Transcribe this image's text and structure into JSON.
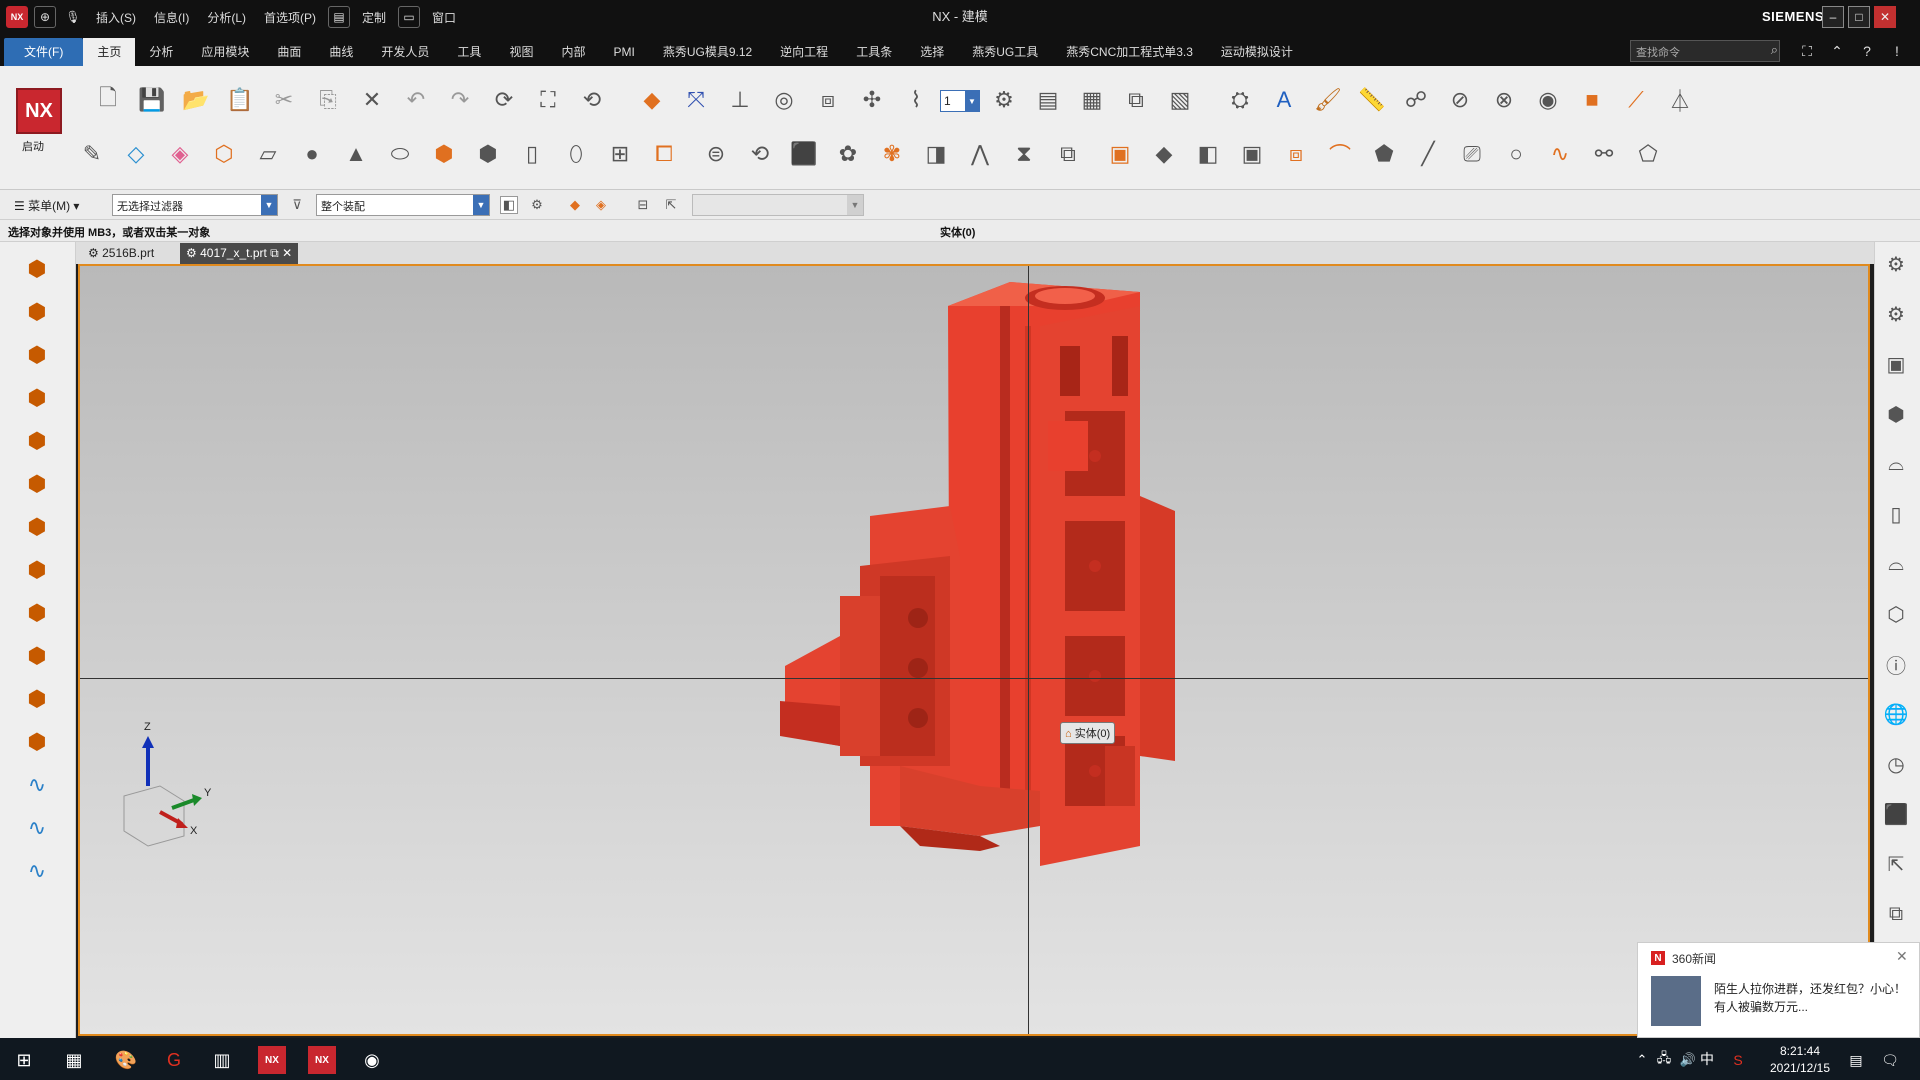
{
  "window": {
    "title": "NX - 建模",
    "brand": "SIEMENS"
  },
  "quick_access": {
    "menus": [
      "插入(S)",
      "信息(I)",
      "分析(L)",
      "首选项(P)",
      "定制",
      "窗口"
    ]
  },
  "ribbon": {
    "file_tab": "文件(F)",
    "tabs": [
      "主页",
      "分析",
      "应用模块",
      "曲面",
      "曲线",
      "开发人员",
      "工具",
      "视图",
      "内部",
      "PMI",
      "燕秀UG模具9.12",
      "逆向工程",
      "工具条",
      "选择",
      "燕秀UG工具",
      "燕秀CNC加工程式单3.3",
      "运动模拟设计"
    ],
    "active_tab": "主页",
    "search_placeholder": "查找命令",
    "start_label": "启动",
    "logo_text": "NX",
    "layer_value": "1"
  },
  "command_bar": {
    "menu_label": "菜单(M)",
    "filter_value": "无选择过滤器",
    "assembly_value": "整个装配"
  },
  "status": {
    "left": "选择对象并使用 MB3，或者双击某一对象",
    "right": "实体(0)"
  },
  "doc_tabs": [
    {
      "label": "2516B.prt"
    },
    {
      "label": "4017_x_t.prt"
    }
  ],
  "viewport": {
    "tooltip": "实体(0)",
    "axis_labels": {
      "z": "Z",
      "y": "Y",
      "x": "X"
    },
    "model_color": "#e8402e",
    "frame_color": "#e08a1e"
  },
  "notification": {
    "source": "360新闻",
    "text": "陌生人拉你进群，还发红包？小心！有人被骗数万元..."
  },
  "taskbar": {
    "ime": "中",
    "time": "8:21:44",
    "date": "2021/12/15"
  }
}
